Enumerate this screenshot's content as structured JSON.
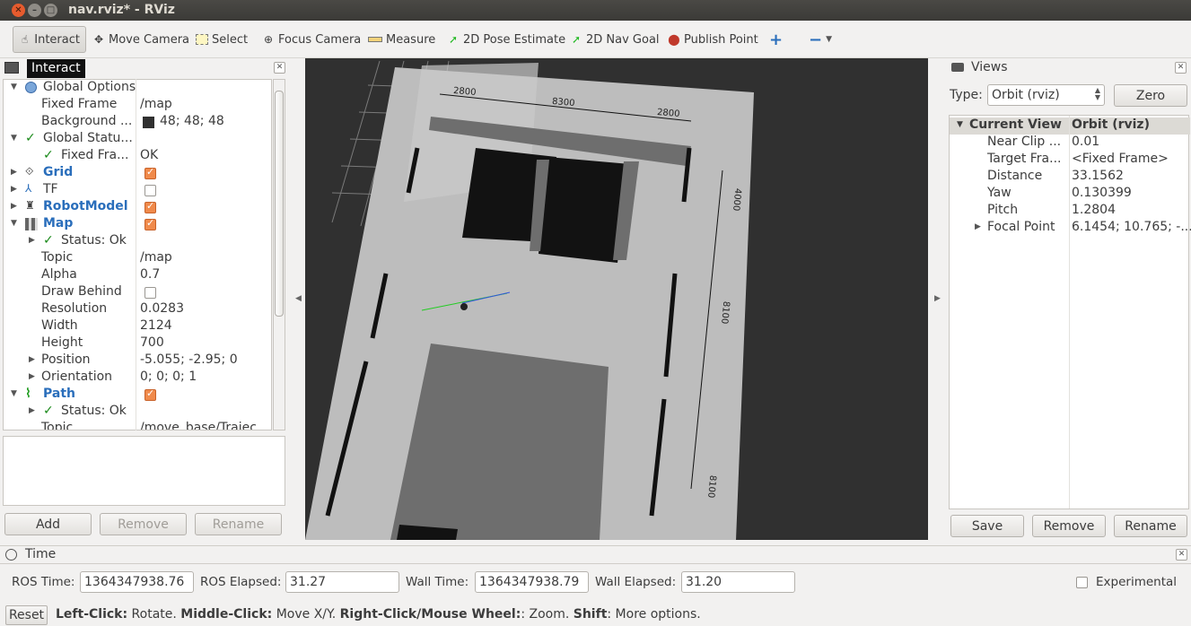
{
  "window": {
    "title": "nav.rviz* - RViz"
  },
  "toolbar": {
    "interact": "Interact",
    "move_camera": "Move Camera",
    "select": "Select",
    "focus_camera": "Focus Camera",
    "measure": "Measure",
    "pose_estimate": "2D Pose Estimate",
    "nav_goal": "2D Nav Goal",
    "publish_point": "Publish Point"
  },
  "tooltip": "Interact",
  "displays": {
    "rows": [
      {
        "name": "Global Options",
        "value": ""
      },
      {
        "name": "Fixed Frame",
        "value": "/map"
      },
      {
        "name": "Background ...",
        "value": "48; 48; 48"
      },
      {
        "name": "Global Statu...",
        "value": ""
      },
      {
        "name": "Fixed Fra...",
        "value": "OK"
      },
      {
        "name": "Grid",
        "value": ""
      },
      {
        "name": "TF",
        "value": ""
      },
      {
        "name": "RobotModel",
        "value": ""
      },
      {
        "name": "Map",
        "value": ""
      },
      {
        "name": "Status: Ok",
        "value": ""
      },
      {
        "name": "Topic",
        "value": "/map"
      },
      {
        "name": "Alpha",
        "value": "0.7"
      },
      {
        "name": "Draw Behind",
        "value": ""
      },
      {
        "name": "Resolution",
        "value": "0.0283"
      },
      {
        "name": "Width",
        "value": "2124"
      },
      {
        "name": "Height",
        "value": "700"
      },
      {
        "name": "Position",
        "value": "-5.055; -2.95; 0"
      },
      {
        "name": "Orientation",
        "value": "0; 0; 0; 1"
      },
      {
        "name": "Path",
        "value": ""
      },
      {
        "name": "Status: Ok",
        "value": ""
      },
      {
        "name": "Topic",
        "value": "/move_base/Trajec"
      }
    ],
    "add": "Add",
    "remove": "Remove",
    "rename": "Rename"
  },
  "map_labels": {
    "a": "2800",
    "b": "8300",
    "c": "2800",
    "d": "4000",
    "e": "8100",
    "f": "8100"
  },
  "views": {
    "title": "Views",
    "type_label": "Type:",
    "type_value": "Orbit (rviz)",
    "zero": "Zero",
    "header_name": "Current View",
    "header_value": "Orbit (rviz)",
    "rows": [
      {
        "name": "Near Clip ...",
        "value": "0.01"
      },
      {
        "name": "Target Fra...",
        "value": "<Fixed Frame>"
      },
      {
        "name": "Distance",
        "value": "33.1562"
      },
      {
        "name": "Yaw",
        "value": "0.130399"
      },
      {
        "name": "Pitch",
        "value": "1.2804"
      },
      {
        "name": "Focal Point",
        "value": "6.1454; 10.765; -..."
      }
    ],
    "save": "Save",
    "remove": "Remove",
    "rename": "Rename"
  },
  "time": {
    "title": "Time",
    "ros_time_label": "ROS Time:",
    "ros_time": "1364347938.76",
    "ros_elapsed_label": "ROS Elapsed:",
    "ros_elapsed": "31.27",
    "wall_time_label": "Wall Time:",
    "wall_time": "1364347938.79",
    "wall_elapsed_label": "Wall Elapsed:",
    "wall_elapsed": "31.20",
    "experimental": "Experimental"
  },
  "status": {
    "reset": "Reset",
    "left_click": "Left-Click:",
    "left_desc": " Rotate. ",
    "middle_click": "Middle-Click:",
    "middle_desc": " Move X/Y. ",
    "right_click": "Right-Click/Mouse Wheel:",
    "right_desc": ": Zoom. ",
    "shift": "Shift",
    "shift_desc": ": More options."
  }
}
